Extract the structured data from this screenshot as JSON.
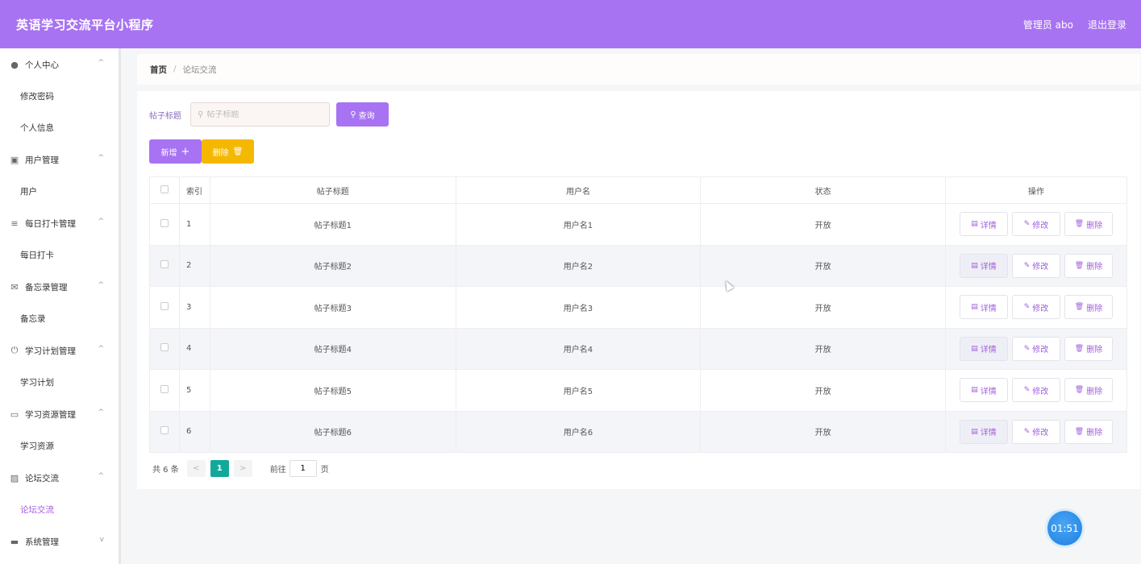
{
  "header": {
    "title": "英语学习交流平台小程序",
    "user_label": "管理员 abo",
    "logout_label": "退出登录"
  },
  "sidebar": {
    "groups": [
      {
        "title": "个人中心",
        "icon": "user-icon",
        "arrow": "^",
        "items": [
          {
            "label": "修改密码"
          },
          {
            "label": "个人信息"
          }
        ]
      },
      {
        "title": "用户管理",
        "icon": "ticket-icon",
        "arrow": "^",
        "items": [
          {
            "label": "用户"
          }
        ]
      },
      {
        "title": "每日打卡管理",
        "icon": "list-icon",
        "arrow": "^",
        "items": [
          {
            "label": "每日打卡"
          }
        ]
      },
      {
        "title": "备忘录管理",
        "icon": "mail-icon",
        "arrow": "^",
        "items": [
          {
            "label": "备忘录"
          }
        ]
      },
      {
        "title": "学习计划管理",
        "icon": "power-icon",
        "arrow": "^",
        "items": [
          {
            "label": "学习计划"
          }
        ]
      },
      {
        "title": "学习资源管理",
        "icon": "monitor-icon",
        "arrow": "^",
        "items": [
          {
            "label": "学习资源"
          }
        ]
      },
      {
        "title": "论坛交流",
        "icon": "chat-icon",
        "arrow": "^",
        "items": [
          {
            "label": "论坛交流",
            "active": true
          }
        ]
      },
      {
        "title": "系统管理",
        "icon": "system-icon",
        "arrow": "v",
        "items": []
      }
    ]
  },
  "breadcrumb": {
    "home": "首页",
    "sep": "/",
    "current": "论坛交流"
  },
  "search": {
    "label": "帖子标题",
    "placeholder": "帖子标题",
    "button": "查询"
  },
  "actions": {
    "add": "新增",
    "delete": "删除"
  },
  "table": {
    "headers": {
      "index": "索引",
      "title": "帖子标题",
      "username": "用户名",
      "status": "状态",
      "ops": "操作"
    },
    "op_labels": {
      "detail": "详情",
      "edit": "修改",
      "delete": "删除"
    },
    "rows": [
      {
        "index": "1",
        "title": "帖子标题1",
        "username": "用户名1",
        "status": "开放"
      },
      {
        "index": "2",
        "title": "帖子标题2",
        "username": "用户名2",
        "status": "开放"
      },
      {
        "index": "3",
        "title": "帖子标题3",
        "username": "用户名3",
        "status": "开放"
      },
      {
        "index": "4",
        "title": "帖子标题4",
        "username": "用户名4",
        "status": "开放"
      },
      {
        "index": "5",
        "title": "帖子标题5",
        "username": "用户名5",
        "status": "开放"
      },
      {
        "index": "6",
        "title": "帖子标题6",
        "username": "用户名6",
        "status": "开放"
      }
    ]
  },
  "pager": {
    "total": "共 6 条",
    "current": "1",
    "goto_label": "前往",
    "goto_value": "1",
    "page_suffix": "页",
    "prev": "<",
    "next": ">"
  },
  "timer": {
    "text": "01:51"
  },
  "colors": {
    "accent": "#a873f2",
    "warning": "#f5b800",
    "pager_active": "#12a99a"
  }
}
